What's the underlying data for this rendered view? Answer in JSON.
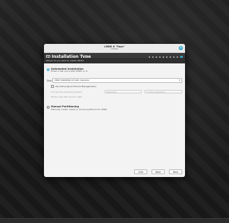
{
  "window": {
    "title": "LMDE 6 \"Faye\"",
    "subtitle": "Installer"
  },
  "header": {
    "title": "Installation Type",
    "question": "Where do you want to install LMDE?",
    "step_count": 10,
    "active_step": 10
  },
  "options": {
    "automated": {
      "title": "Automated Installation",
      "desc": "Erase a disk and install LMDE on it."
    },
    "manual": {
      "title": "Manual Partitioning",
      "desc": "Manually create, resize or choose partitions for LMDE."
    }
  },
  "disk": {
    "label": "Disk:",
    "selected": "VBOX HARDDISK (25 GB) (/dev/sda)"
  },
  "lvm": {
    "label": "Use LVM (Logical Volume Management)"
  },
  "encrypt": {
    "label": "Encrypt the operating system",
    "passphrase_placeholder": "Passphrase",
    "confirm_placeholder": "Confirm passphrase"
  },
  "fill": {
    "label": "Fill the disk with random data"
  },
  "buttons": {
    "quit": "Quit",
    "back": "Back",
    "next": "Next"
  },
  "colors": {
    "accent": "#35a7c9",
    "header_bg": "#3a3a3a"
  }
}
